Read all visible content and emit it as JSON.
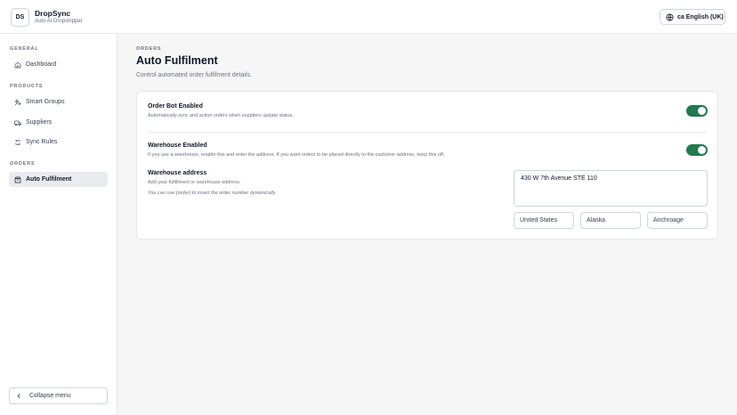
{
  "header": {
    "logo_text": "DS",
    "brand_name": "DropSync",
    "brand_sub": "Auto AI Dropshipper",
    "language": "English (UK)",
    "language_code": "ca"
  },
  "sidebar": {
    "sections": [
      {
        "title": "GENERAL",
        "items": [
          {
            "label": "Dashboard",
            "icon": "home-icon"
          }
        ]
      },
      {
        "title": "PRODUCTS",
        "items": [
          {
            "label": "Smart Groups",
            "icon": "sparkles-icon"
          },
          {
            "label": "Suppliers",
            "icon": "truck-icon"
          },
          {
            "label": "Sync Rules",
            "icon": "refresh-icon"
          }
        ]
      },
      {
        "title": "ORDERS",
        "items": [
          {
            "label": "Auto Fulfilment",
            "icon": "box-icon",
            "active": true
          }
        ]
      }
    ],
    "collapse_label": "Collapse menu"
  },
  "main": {
    "eyebrow": "ORDERS",
    "title": "Auto Fulfilment",
    "description": "Control automated order fulfilment details.",
    "order_bot": {
      "title": "Order Bot Enabled",
      "help": "Automatically sync and action orders when suppliers update status.",
      "enabled": true
    },
    "warehouse": {
      "title": "Warehouse Enabled",
      "help": "If you use a warehouse, enable this and enter the address. If you want orders to be placed directly to the customer address, keep this off.",
      "enabled": true
    },
    "address": {
      "title": "Warehouse address",
      "help": "Add your fulfillment or warehouse address.",
      "note": "You can use {order} to insert the order number dynamically.",
      "line": "430 W 7th Avenue STE 110",
      "country": "United States",
      "state": "Alaska",
      "city": "Anchroage"
    }
  },
  "colors": {
    "accent": "#217a4e",
    "background": "#f6f6f7",
    "border": "#e5e7eb"
  }
}
